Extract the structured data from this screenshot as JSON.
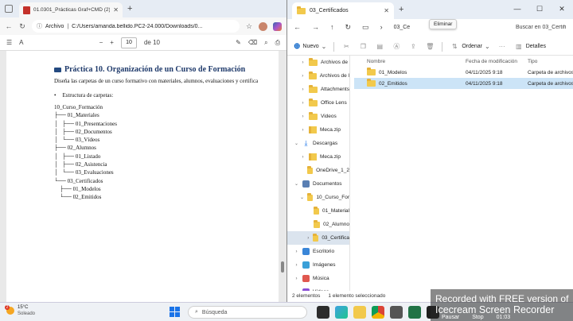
{
  "edge": {
    "tab_title": "01.0301_Prácticas Graf+CMD (2).pdf",
    "address_label": "Archivo",
    "address_path": "C:/Users/amanda.bellido.PC2-24.000/Downloads/0...",
    "page_number": "10",
    "page_total": "de 10",
    "heading": "Práctica 10. Organización de un Curso de Formación",
    "paragraph": "Diseña las carpetas de un curso formativo con materiales, alumnos, evaluaciones y certifica",
    "bullet": "Estructura de carpetas:",
    "tree": [
      "10_Curso_Formación",
      "├── 01_Materiales",
      "│   ├── 01_Presentaciones",
      "│   ├── 02_Documentos",
      "│   └── 03_Vídeos",
      "├── 02_Alumnos",
      "│   ├── 01_Listado",
      "│   ├── 02_Asistencia",
      "│   └── 03_Evaluaciones",
      "└── 03_Certificados",
      "    ├── 01_Modelos",
      "    └── 02_Emitidos"
    ]
  },
  "explorer": {
    "tab_title": "03_Certificados",
    "crumb": "03_Ce",
    "search_placeholder": "Buscar en 03_Certifi",
    "tooltip": "Eliminar",
    "new_label": "Nuevo",
    "sort_label": "Ordenar",
    "details_label": "Detalles",
    "sidebar": [
      {
        "label": "Archivos de",
        "indent": 1,
        "kind": "folder",
        "chev": "›"
      },
      {
        "label": "Archivos de l",
        "indent": 1,
        "kind": "folder",
        "chev": "›"
      },
      {
        "label": "Attachments",
        "indent": 1,
        "kind": "folder",
        "chev": "›"
      },
      {
        "label": "Office Lens",
        "indent": 1,
        "kind": "folder",
        "chev": "›"
      },
      {
        "label": "Videos",
        "indent": 1,
        "kind": "folder",
        "chev": "›"
      },
      {
        "label": "Meca.zip",
        "indent": 1,
        "kind": "zip",
        "chev": "›"
      },
      {
        "label": "Descargas",
        "indent": 0,
        "kind": "download",
        "chev": "⌄"
      },
      {
        "label": "Meca.zip",
        "indent": 1,
        "kind": "zip",
        "chev": "›"
      },
      {
        "label": "OneDrive_1_2",
        "indent": 1,
        "kind": "folder",
        "chev": ""
      },
      {
        "label": "Documentos",
        "indent": 0,
        "kind": "docs",
        "chev": "⌄"
      },
      {
        "label": "10_Curso_For",
        "indent": 1,
        "kind": "folder",
        "chev": "⌄"
      },
      {
        "label": "01_Material",
        "indent": 2,
        "kind": "folder",
        "chev": ""
      },
      {
        "label": "02_Alumno",
        "indent": 2,
        "kind": "folder",
        "chev": ""
      },
      {
        "label": "03_Certifica",
        "indent": 2,
        "kind": "folder",
        "chev": "›",
        "selected": true
      },
      {
        "label": "Escritorio",
        "indent": 0,
        "kind": "desktop",
        "chev": "›"
      },
      {
        "label": "Imágenes",
        "indent": 0,
        "kind": "images",
        "chev": "›"
      },
      {
        "label": "Música",
        "indent": 0,
        "kind": "music",
        "chev": "›"
      },
      {
        "label": "Vídeos",
        "indent": 0,
        "kind": "videos",
        "chev": "›"
      }
    ],
    "columns": [
      "Nombre",
      "Fecha de modificación",
      "Tipo"
    ],
    "rows": [
      {
        "name": "01_Modelos",
        "date": "04/11/2025 9:18",
        "type": "Carpeta de archivos",
        "selected": false
      },
      {
        "name": "02_Emitidos",
        "date": "04/11/2025 9:18",
        "type": "Carpeta de archivos",
        "selected": true
      }
    ],
    "status_count": "2 elementos",
    "status_selected": "1 elemento seleccionado"
  },
  "watermark": {
    "line1": "Recorded with FREE version of",
    "line2": "Icecream  Screen  Recorder",
    "pause": "Pausar",
    "stop": "Stop",
    "time": "01:03"
  },
  "taskbar": {
    "badge": "2",
    "temperature": "15°C",
    "weather": "Soleado",
    "search_placeholder": "Búsqueda"
  }
}
